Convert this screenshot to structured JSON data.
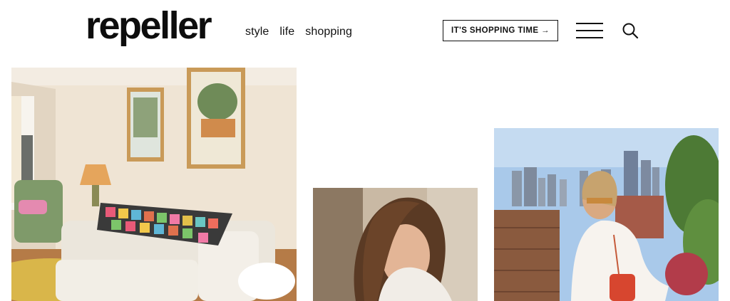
{
  "brand": {
    "logo_text": "repeller"
  },
  "nav": {
    "items": [
      "style",
      "life",
      "shopping"
    ]
  },
  "header": {
    "cta_label": "IT'S SHOPPING TIME →",
    "menu_icon": "hamburger-icon",
    "search_icon": "search-icon"
  },
  "colors": {
    "text": "#111111",
    "background": "#ffffff"
  }
}
